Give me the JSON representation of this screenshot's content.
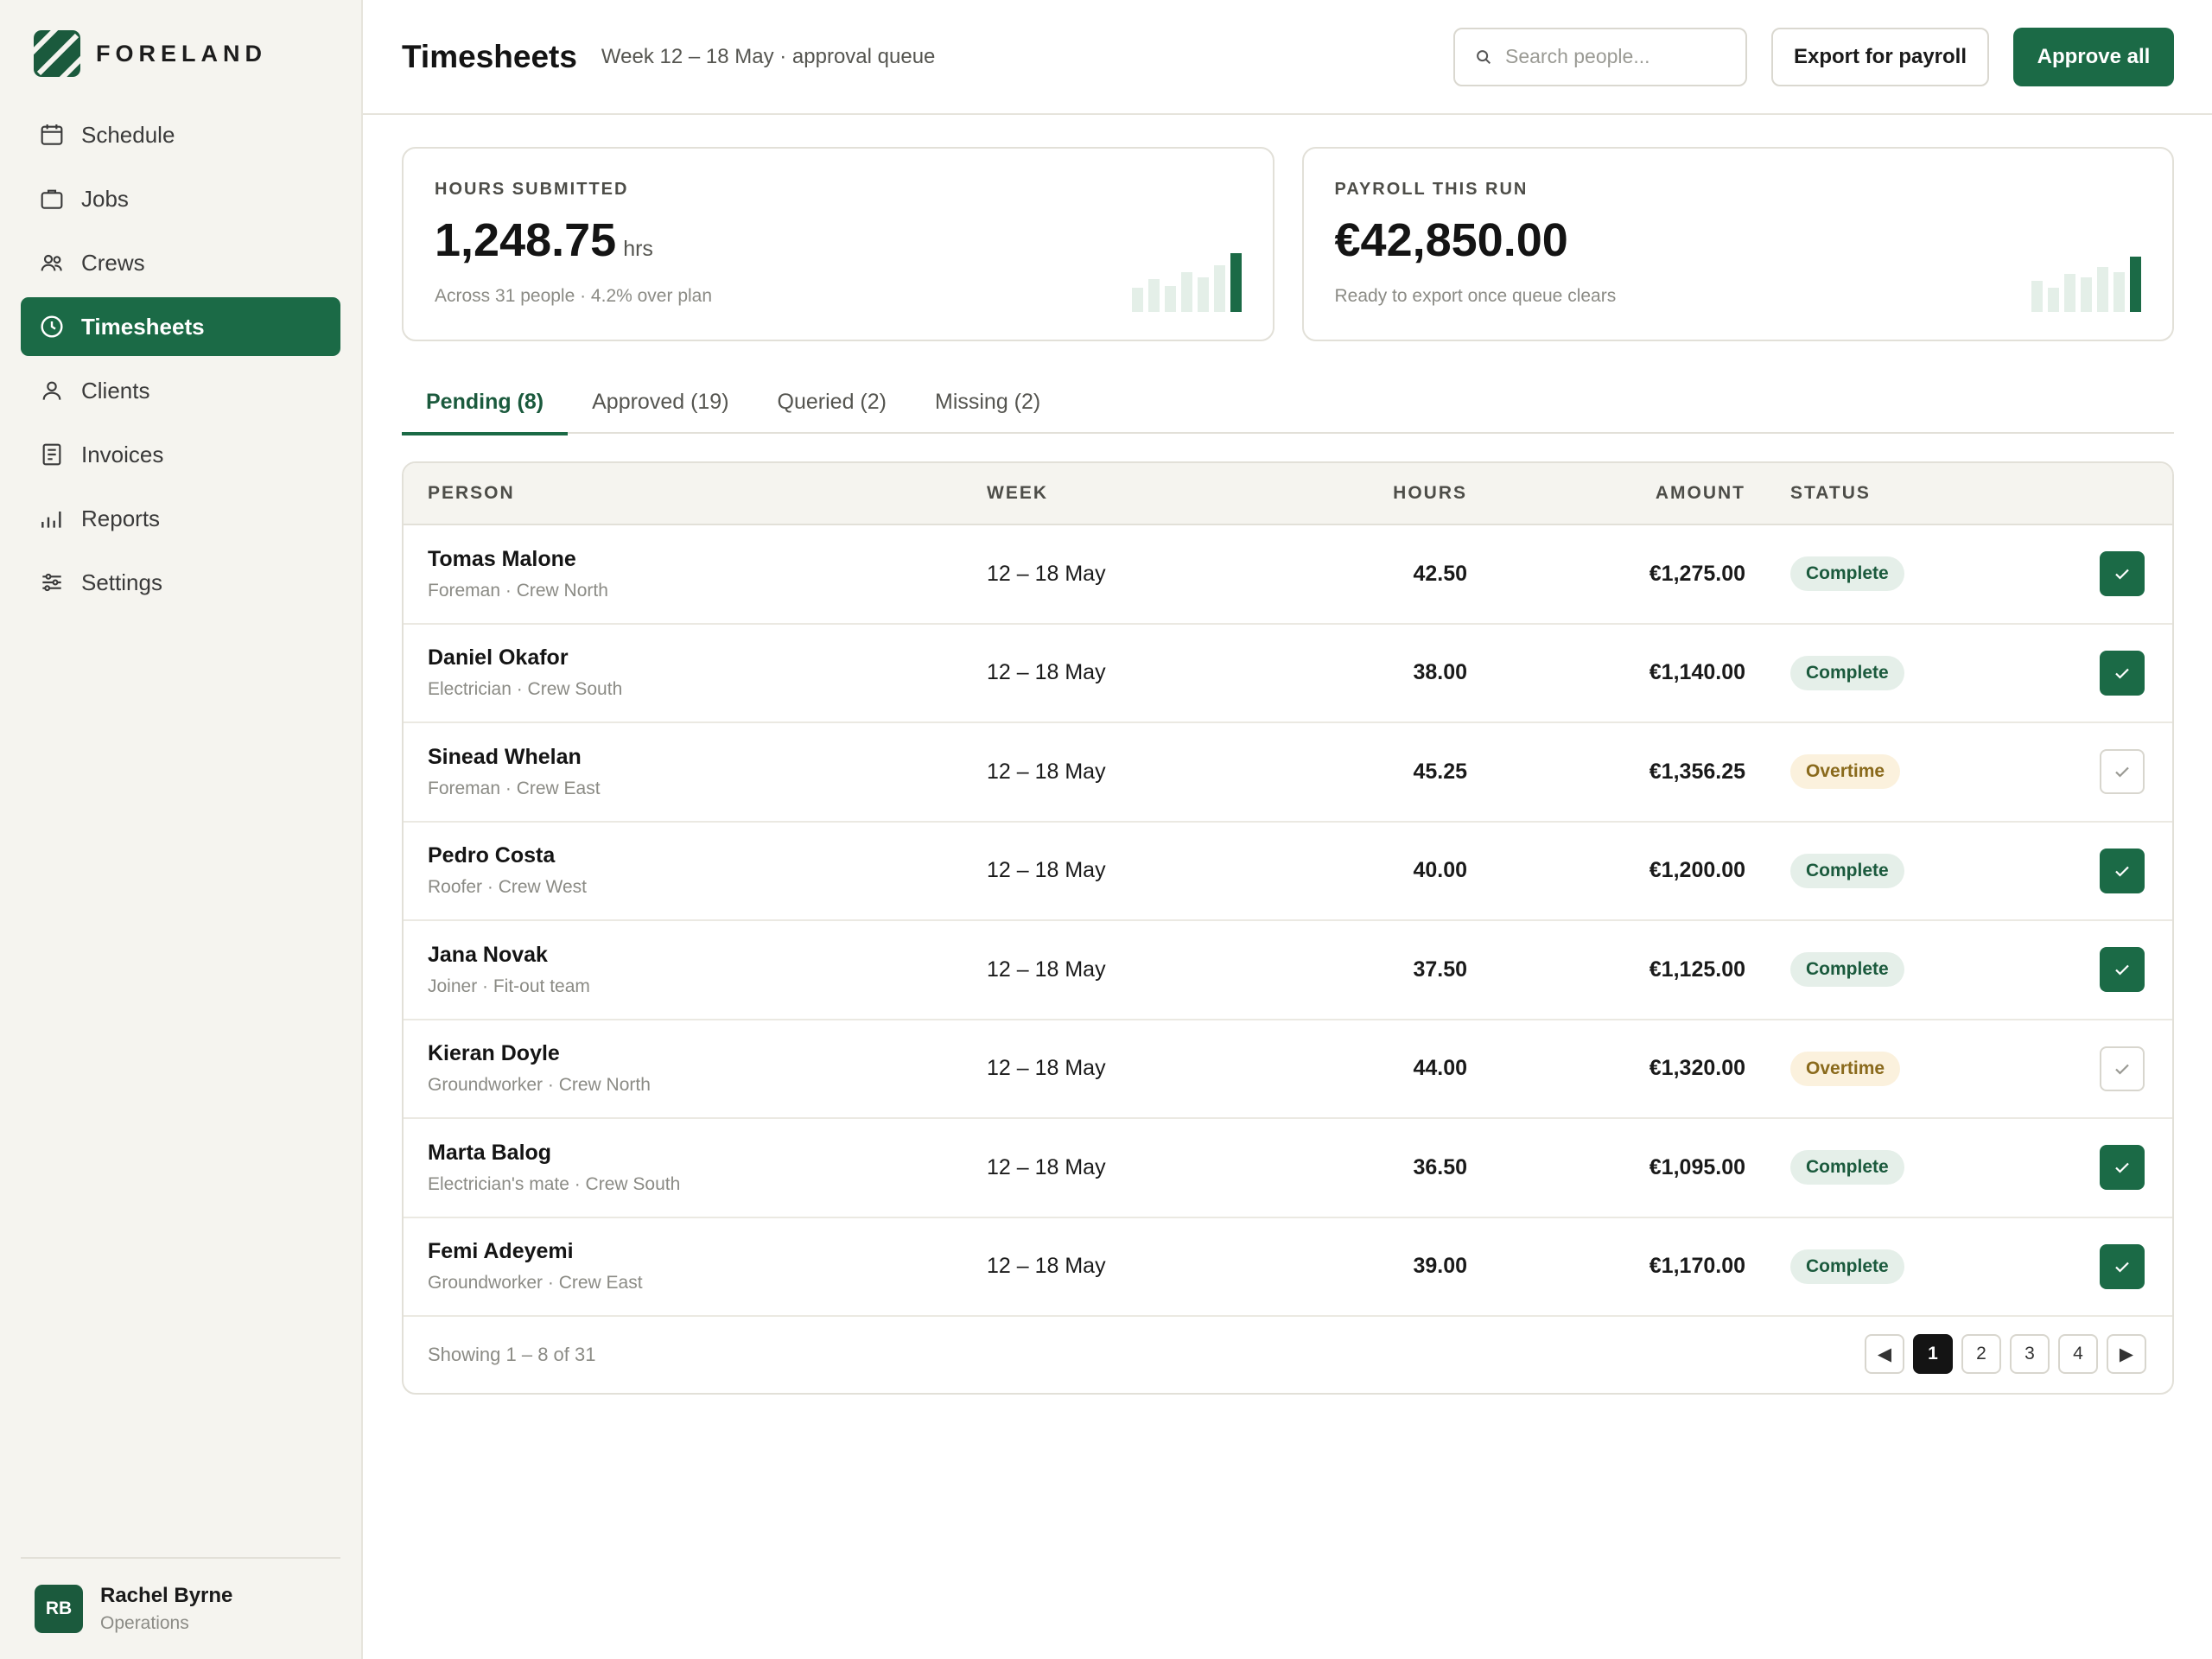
{
  "brand": {
    "name": "FORELAND",
    "logo_icon": "striped-square-logo",
    "accent": "#1b6a46"
  },
  "sidebar": {
    "items": [
      {
        "label": "Schedule",
        "icon": "calendar-icon"
      },
      {
        "label": "Jobs",
        "icon": "briefcase-icon"
      },
      {
        "label": "Crews",
        "icon": "users-icon"
      },
      {
        "label": "Timesheets",
        "icon": "clock-icon",
        "active": true
      },
      {
        "label": "Clients",
        "icon": "person-icon"
      },
      {
        "label": "Invoices",
        "icon": "document-icon"
      },
      {
        "label": "Reports",
        "icon": "bar-chart-icon"
      },
      {
        "label": "Settings",
        "icon": "sliders-icon"
      }
    ],
    "user": {
      "initials": "RB",
      "name": "Rachel Byrne",
      "role": "Operations"
    }
  },
  "header": {
    "title": "Timesheets",
    "subtitle": "Week 12 – 18 May · approval queue",
    "search_placeholder": "Search people...",
    "export_label": "Export for payroll",
    "approve_label": "Approve all"
  },
  "cards": {
    "hours": {
      "label": "HOURS SUBMITTED",
      "value": "1,248.75",
      "unit": "hrs",
      "sub": "Across 31 people · 4.2% over plan"
    },
    "payroll": {
      "label": "PAYROLL THIS RUN",
      "value": "€42,850.00",
      "sub": "Ready to export once queue clears"
    }
  },
  "tabs": [
    {
      "label": "Pending (8)",
      "active": true
    },
    {
      "label": "Approved (19)"
    },
    {
      "label": "Queried (2)"
    },
    {
      "label": "Missing (2)"
    }
  ],
  "table": {
    "headers": {
      "person": "PERSON",
      "week": "WEEK",
      "hours": "HOURS",
      "amount": "AMOUNT",
      "status": "STATUS"
    },
    "rows": [
      {
        "name": "Tomas Malone",
        "role": "Foreman · Crew North",
        "week": "12 – 18 May",
        "hours": "42.50",
        "amount": "€1,275.00",
        "status": "Complete",
        "checked": true
      },
      {
        "name": "Daniel Okafor",
        "role": "Electrician · Crew South",
        "week": "12 – 18 May",
        "hours": "38.00",
        "amount": "€1,140.00",
        "status": "Complete",
        "checked": true
      },
      {
        "name": "Sinead Whelan",
        "role": "Foreman · Crew East",
        "week": "12 – 18 May",
        "hours": "45.25",
        "amount": "€1,356.25",
        "status": "Overtime",
        "checked": false
      },
      {
        "name": "Pedro Costa",
        "role": "Roofer · Crew West",
        "week": "12 – 18 May",
        "hours": "40.00",
        "amount": "€1,200.00",
        "status": "Complete",
        "checked": true
      },
      {
        "name": "Jana Novak",
        "role": "Joiner · Fit-out team",
        "week": "12 – 18 May",
        "hours": "37.50",
        "amount": "€1,125.00",
        "status": "Complete",
        "checked": true
      },
      {
        "name": "Kieran Doyle",
        "role": "Groundworker · Crew North",
        "week": "12 – 18 May",
        "hours": "44.00",
        "amount": "€1,320.00",
        "status": "Overtime",
        "checked": false
      },
      {
        "name": "Marta Balog",
        "role": "Electrician's mate · Crew South",
        "week": "12 – 18 May",
        "hours": "36.50",
        "amount": "€1,095.00",
        "status": "Complete",
        "checked": true
      },
      {
        "name": "Femi Adeyemi",
        "role": "Groundworker · Crew East",
        "week": "12 – 18 May",
        "hours": "39.00",
        "amount": "€1,170.00",
        "status": "Complete",
        "checked": true
      }
    ],
    "footer": "Showing 1 – 8 of 31",
    "pagination": {
      "prev": "◀",
      "pages": [
        "1",
        "2",
        "3",
        "4"
      ],
      "current": "1",
      "next": "▶"
    }
  }
}
